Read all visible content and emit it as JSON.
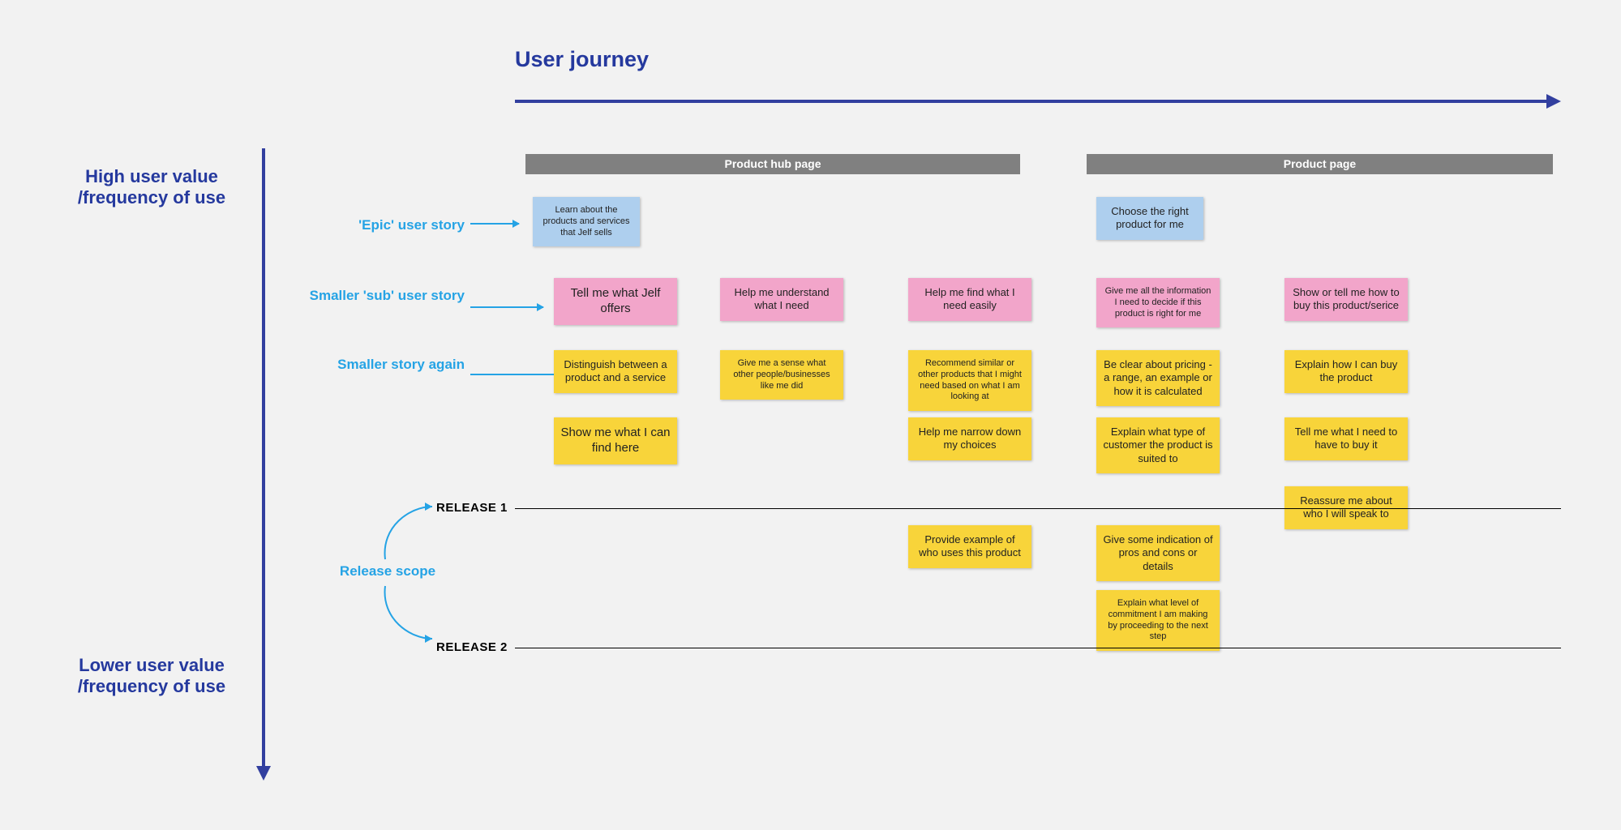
{
  "title": "User journey",
  "axis": {
    "high": "High user value /frequency of use",
    "low": "Lower user value /frequency of use"
  },
  "legend": {
    "epic": "'Epic' user story",
    "sub": "Smaller 'sub' user story",
    "small": "Smaller story again",
    "scope": "Release  scope"
  },
  "columns": {
    "hub": "Product hub page",
    "page": "Product page"
  },
  "releases": {
    "r1": "RELEASE 1",
    "r2": "RELEASE 2"
  },
  "notes": {
    "epic_hub": "Learn about the products and services that Jelf sells",
    "epic_page": "Choose the right product for me",
    "sub": {
      "c1": "Tell me what Jelf offers",
      "c2": "Help me understand what I need",
      "c3": "Help me find what I need easily",
      "c4": "Give me all the information I need to decide if this product is right for me",
      "c5": "Show or tell me how to buy this product/serice"
    },
    "small": {
      "c1a": "Distinguish between a product and a service",
      "c1b": "Show me what I can find here",
      "c2a": "Give me a sense what other people/businesses like me did",
      "c3a": "Recommend similar or other products that I might need based on what I am looking at",
      "c3b": "Help me narrow down my choices",
      "c4a": "Be clear about pricing - a range, an example or how it is calculated",
      "c4b": "Explain what type of customer the product is suited to",
      "c5a": "Explain how I can buy the product",
      "c5b": "Tell me what I need to have to buy it",
      "c5c": "Reassure me about who I will speak to"
    },
    "rel1": {
      "c3": "Provide example of who uses this product",
      "c4a": "Give some indication of pros and cons or details",
      "c4b": "Explain what level of commitment I am making by proceeding to the next step"
    }
  }
}
